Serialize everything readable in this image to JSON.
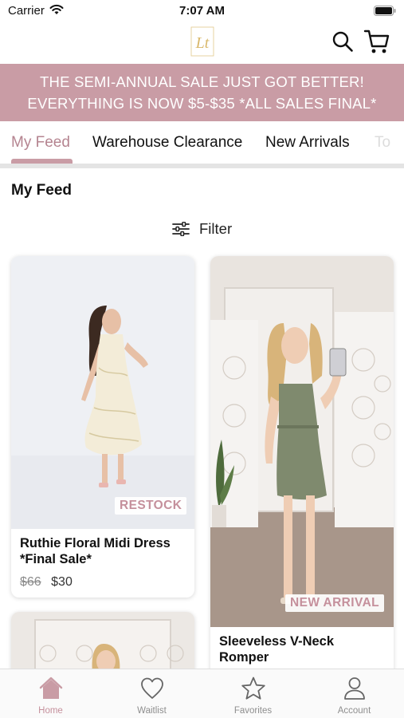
{
  "status_bar": {
    "carrier": "Carrier",
    "time": "7:07 AM"
  },
  "header": {
    "logo_text": "Lt",
    "icons": [
      "search-icon",
      "cart-icon"
    ]
  },
  "banner": {
    "line1": "THE SEMI-ANNUAL SALE JUST GOT BETTER!",
    "line2": "EVERYTHING IS NOW $5-$35 *ALL SALES FINAL*",
    "background": "#c99ca5"
  },
  "tabs": [
    {
      "label": "My Feed",
      "active": true
    },
    {
      "label": "Warehouse Clearance",
      "active": false
    },
    {
      "label": "New Arrivals",
      "active": false
    },
    {
      "label": "To",
      "active": false
    }
  ],
  "feed": {
    "title": "My Feed",
    "filter_label": "Filter"
  },
  "products": [
    {
      "name_line1": "Ruthie Floral Midi Dress",
      "name_line2": "*Final Sale*",
      "old_price": "$66",
      "price": "$30",
      "badge": "RESTOCK"
    },
    {
      "name_line1": "Sleeveless V-Neck",
      "name_line2": "Romper",
      "badge": "NEW ARRIVAL"
    }
  ],
  "bottom_nav": [
    {
      "label": "Home",
      "icon": "home-icon",
      "active": true
    },
    {
      "label": "Waitlist",
      "icon": "heart-icon",
      "active": false
    },
    {
      "label": "Favorites",
      "icon": "star-icon",
      "active": false
    },
    {
      "label": "Account",
      "icon": "person-icon",
      "active": false
    }
  ],
  "colors": {
    "accent": "#c99ca5",
    "accent_text": "#b58490"
  }
}
